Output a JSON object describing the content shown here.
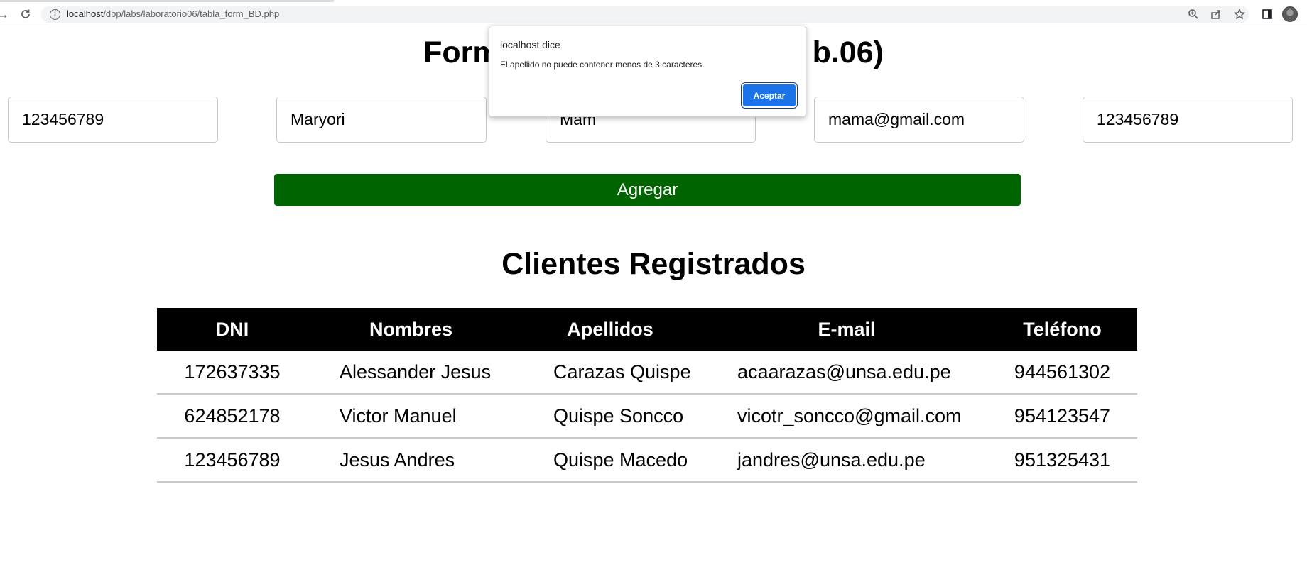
{
  "browser": {
    "url_host": "localhost",
    "url_path": "/dbp/labs/laboratorio06/tabla_form_BD.php",
    "icons": [
      "forward-icon",
      "reload-icon",
      "info-icon",
      "zoom-icon",
      "share-icon",
      "star-icon",
      "sidepanel-icon",
      "profile-avatar"
    ]
  },
  "page": {
    "title_left": "Form",
    "title_right": "b.06)"
  },
  "form": {
    "dni_value": "123456789",
    "nombres_value": "Maryori",
    "apellidos_value": "Mam",
    "email_value": "mama@gmail.com",
    "telefono_value": "123456789",
    "add_label": "Agregar",
    "add_color": "#006400"
  },
  "clients": {
    "title": "Clientes Registrados",
    "headers": [
      "DNI",
      "Nombres",
      "Apellidos",
      "E-mail",
      "Teléfono"
    ],
    "rows": [
      [
        "172637335",
        "Alessander Jesus",
        "Carazas Quispe",
        "acaarazas@unsa.edu.pe",
        "944561302"
      ],
      [
        "624852178",
        "Victor Manuel",
        "Quispe Soncco",
        "vicotr_soncco@gmail.com",
        "954123547"
      ],
      [
        "123456789",
        "Jesus Andres",
        "Quispe Macedo",
        "jandres@unsa.edu.pe",
        "951325431"
      ]
    ]
  },
  "dialog": {
    "title": "localhost dice",
    "message": "El apellido no puede contener menos de 3 caracteres.",
    "button_label": "Aceptar",
    "button_color": "#1a73e8"
  }
}
